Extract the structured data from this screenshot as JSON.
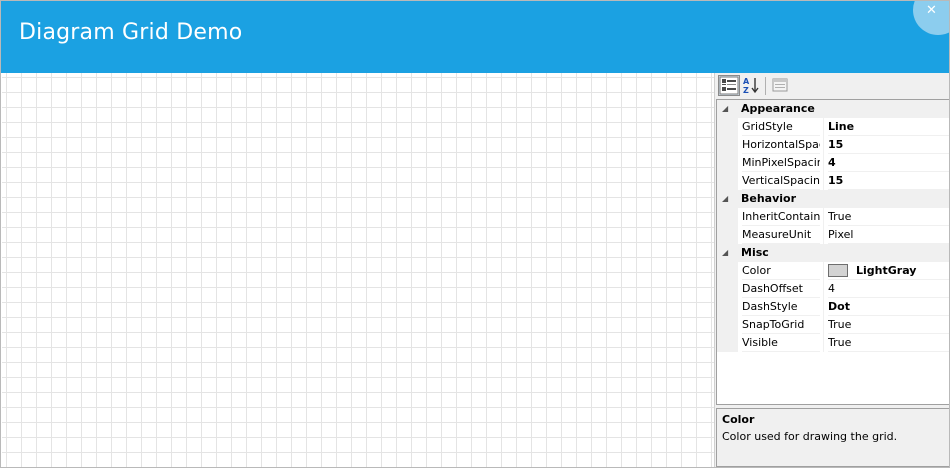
{
  "window": {
    "title": "Diagram Grid Demo",
    "close_glyph": "✕",
    "accent_color": "#1ba1e2"
  },
  "property_grid": {
    "toolbar": {
      "categorized_icon": "categorized-view-icon",
      "alphabetical_icon": "alphabetical-sort-icon",
      "property_pages_icon": "property-pages-icon"
    },
    "categories": [
      {
        "name": "Appearance",
        "expanded": true,
        "properties": [
          {
            "name": "GridStyle",
            "value": "Line",
            "bold": true
          },
          {
            "name": "HorizontalSpacing",
            "value": "15",
            "bold": true
          },
          {
            "name": "MinPixelSpacing",
            "value": "4",
            "bold": true
          },
          {
            "name": "VerticalSpacing",
            "value": "15",
            "bold": true
          }
        ]
      },
      {
        "name": "Behavior",
        "expanded": true,
        "properties": [
          {
            "name": "InheritContainerStyle",
            "value": "True",
            "bold": false
          },
          {
            "name": "MeasureUnit",
            "value": "Pixel",
            "bold": false
          }
        ]
      },
      {
        "name": "Misc",
        "expanded": true,
        "properties": [
          {
            "name": "Color",
            "value": "LightGray",
            "bold": true,
            "swatch": "#d3d3d3"
          },
          {
            "name": "DashOffset",
            "value": "4",
            "bold": false
          },
          {
            "name": "DashStyle",
            "value": "Dot",
            "bold": true
          },
          {
            "name": "SnapToGrid",
            "value": "True",
            "bold": false
          },
          {
            "name": "Visible",
            "value": "True",
            "bold": false
          }
        ]
      }
    ],
    "description": {
      "title": "Color",
      "text": "Color used for drawing the grid."
    }
  }
}
